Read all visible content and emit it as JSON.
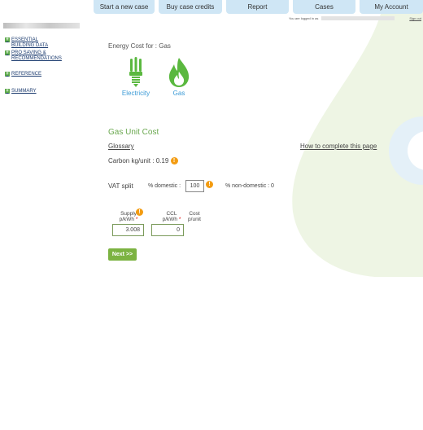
{
  "nav": {
    "items": [
      "Start a new case",
      "Buy case credits",
      "Report",
      "Cases",
      "My Account"
    ]
  },
  "userbar": {
    "logged_in_as": "You are logged in as",
    "sign_out": "Sign out"
  },
  "sidebar": {
    "items": [
      {
        "label_line1": "ESSENTIAL",
        "label_line2": "BUILDING DATA"
      },
      {
        "label_line1": "PRO SAVING &",
        "label_line2": "RECOMMENDATIONS"
      },
      {
        "label_line1": "REFERENCE",
        "label_line2": ""
      },
      {
        "label_line1": "SUMMARY",
        "label_line2": ""
      }
    ]
  },
  "main": {
    "energy_title": "Energy Cost for : Gas",
    "options": [
      {
        "label": "Electricity",
        "icon": "bulb-icon"
      },
      {
        "label": "Gas",
        "icon": "flame-icon"
      }
    ],
    "section_title": "Gas Unit Cost",
    "glossary": "Glossary",
    "howto": "How to complete this page",
    "carbon": "Carbon kg/unit : 0.19",
    "vat": {
      "label": "VAT split",
      "domestic_label": "% domestic :",
      "domestic_value": "100",
      "nondomestic": "% non-domestic : 0"
    },
    "columns": {
      "supply_line1": "Supply",
      "supply_line2": "p/kWh",
      "ccl_line1": "CCL",
      "ccl_line2": "p/kWh",
      "cost_line1": "Cost",
      "cost_line2": "p/unit",
      "supply_value": "3.008",
      "ccl_value": "0"
    },
    "next": "Next >>"
  },
  "colors": {
    "nav_bg": "#cfe6f5",
    "green": "#6aa84f",
    "blue_link": "#3a9ad6",
    "info": "#f39c12"
  }
}
